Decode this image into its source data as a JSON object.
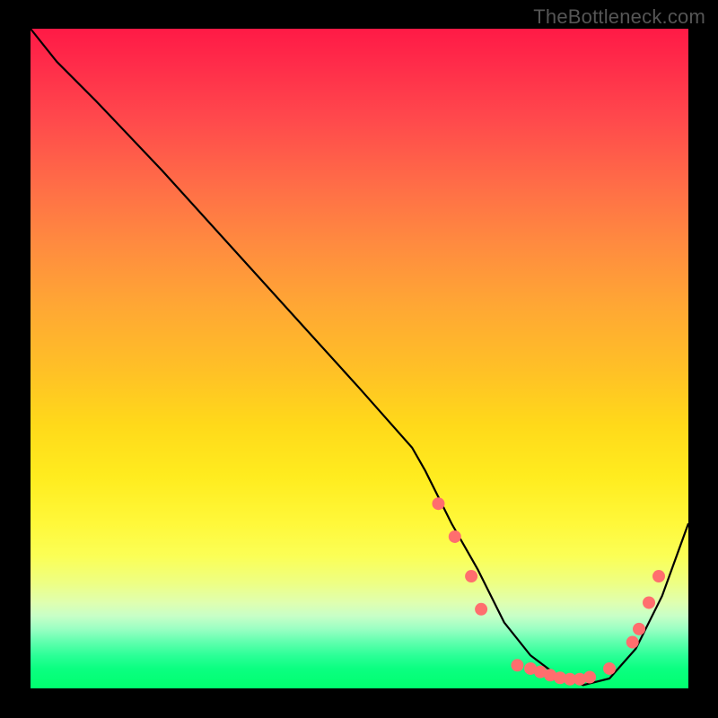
{
  "watermark": "TheBottleneck.com",
  "chart_data": {
    "type": "line",
    "title": "",
    "xlabel": "",
    "ylabel": "",
    "xlim": [
      0,
      100
    ],
    "ylim": [
      0,
      100
    ],
    "grid": false,
    "series": [
      {
        "name": "bottleneck-curve",
        "x": [
          0,
          4,
          10,
          20,
          30,
          40,
          50,
          58,
          60,
          64,
          68,
          72,
          76,
          80,
          84,
          88,
          92,
          96,
          100
        ],
        "y": [
          100,
          95,
          89,
          78.5,
          67.5,
          56.5,
          45.5,
          36.5,
          33,
          25,
          18,
          10,
          5,
          2,
          0.5,
          1.5,
          6,
          14,
          25
        ],
        "color": "#000000",
        "width": 2.2
      }
    ],
    "markers": {
      "name": "highlight-dots",
      "color": "#ff6e6e",
      "radius": 7,
      "points": [
        {
          "x": 62,
          "y": 28
        },
        {
          "x": 64.5,
          "y": 23
        },
        {
          "x": 67,
          "y": 17
        },
        {
          "x": 68.5,
          "y": 12
        },
        {
          "x": 74,
          "y": 3.5
        },
        {
          "x": 76,
          "y": 3
        },
        {
          "x": 77.5,
          "y": 2.5
        },
        {
          "x": 79,
          "y": 2
        },
        {
          "x": 80.5,
          "y": 1.6
        },
        {
          "x": 82,
          "y": 1.4
        },
        {
          "x": 83.5,
          "y": 1.4
        },
        {
          "x": 85,
          "y": 1.7
        },
        {
          "x": 88,
          "y": 3
        },
        {
          "x": 91.5,
          "y": 7
        },
        {
          "x": 92.5,
          "y": 9
        },
        {
          "x": 94,
          "y": 13
        },
        {
          "x": 95.5,
          "y": 17
        }
      ]
    }
  }
}
